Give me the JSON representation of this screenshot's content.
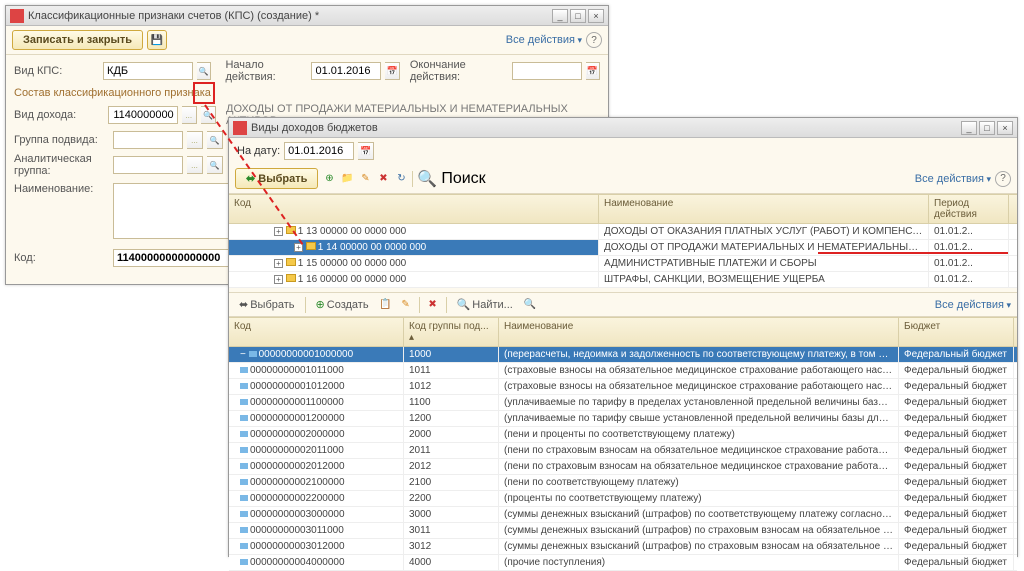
{
  "w1": {
    "title": "Классификационные признаки счетов (КПС) (создание) *",
    "save_close": "Записать и закрыть",
    "all_actions": "Все действия",
    "labels": {
      "vid_kps": "Вид КПС:",
      "nachalo": "Начало действия:",
      "okonchanie": "Окончание действия:",
      "sostav": "Состав классификационного признака",
      "vid_dohoda": "Вид дохода:",
      "gruppa": "Группа подвида:",
      "analit": "Аналитическая группа:",
      "naim": "Наименование:",
      "kod": "Код:"
    },
    "values": {
      "vid_kps": "КДБ",
      "nachalo": "01.01.2016",
      "vid_dohoda": "1140000000",
      "descr": "ДОХОДЫ ОТ ПРОДАЖИ МАТЕРИАЛЬНЫХ И НЕМАТЕРИАЛЬНЫХ АКТИВОВ",
      "kod": "11400000000000000"
    }
  },
  "w2": {
    "title": "Виды доходов бюджетов",
    "na_datu_label": "На дату:",
    "na_datu": "01.01.2016",
    "vybrat": "Выбрать",
    "poisk": "Поиск",
    "all_actions": "Все действия",
    "g1_headers": {
      "kod": "Код",
      "naim": "Наименование",
      "period": "Период действия"
    },
    "g1_rows": [
      {
        "kod": "1 13 00000 00 0000 000",
        "naim": "ДОХОДЫ ОТ ОКАЗАНИЯ ПЛАТНЫХ УСЛУГ (РАБОТ) И КОМПЕНСАЦИИ ЗАТРАТ ГОСУДАРСТВА",
        "period": "01.01.2..",
        "sel": false
      },
      {
        "kod": "1 14 00000 00 0000 000",
        "naim": "ДОХОДЫ ОТ ПРОДАЖИ МАТЕРИАЛЬНЫХ И НЕМАТЕРИАЛЬНЫХ АКТИВОВ",
        "period": "01.01.2..",
        "sel": true
      },
      {
        "kod": "1 15 00000 00 0000 000",
        "naim": "АДМИНИСТРАТИВНЫЕ ПЛАТЕЖИ И СБОРЫ",
        "period": "01.01.2..",
        "sel": false
      },
      {
        "kod": "1 16 00000 00 0000 000",
        "naim": "ШТРАФЫ, САНКЦИИ, ВОЗМЕЩЕНИЕ УЩЕРБА",
        "period": "01.01.2..",
        "sel": false
      }
    ],
    "toolbar2": {
      "vybrat": "Выбрать",
      "sozdat": "Создать",
      "naiti": "Найти..."
    },
    "g2_headers": {
      "kod": "Код",
      "grp": "Код группы под... ▴",
      "naim": "Наименование",
      "budget": "Бюджет"
    },
    "g2_rows": [
      {
        "kod": "00000000001000000",
        "grp": "1000",
        "naim": "(перерасчеты, недоимка и задолженность по соответствующему платежу, в том числе ...",
        "budget": "Федеральный бюджет",
        "sel": true
      },
      {
        "kod": "00000000001011000",
        "grp": "1011",
        "naim": "(страховые взносы на обязательное медицинское страхование работающего населени...",
        "budget": "Федеральный бюджет"
      },
      {
        "kod": "00000000001012000",
        "grp": "1012",
        "naim": "(страховые взносы на обязательное медицинское страхование работающего населени...",
        "budget": "Федеральный бюджет"
      },
      {
        "kod": "00000000001100000",
        "grp": "1100",
        "naim": "(уплачиваемые по тарифу в пределах установленной предельной величины базы для на...",
        "budget": "Федеральный бюджет"
      },
      {
        "kod": "00000000001200000",
        "grp": "1200",
        "naim": "(уплачиваемые по тарифу свыше установленной предельной величины базы для начисл...",
        "budget": "Федеральный бюджет"
      },
      {
        "kod": "00000000002000000",
        "grp": "2000",
        "naim": "(пени и проценты по соответствующему платежу)",
        "budget": "Федеральный бюджет"
      },
      {
        "kod": "00000000002011000",
        "grp": "2011",
        "naim": "(пени по страховым взносам на обязательное медицинское страхование работающего ...",
        "budget": "Федеральный бюджет"
      },
      {
        "kod": "00000000002012000",
        "grp": "2012",
        "naim": "(пени по страховым взносам на обязательное медицинское страхование работающего ...",
        "budget": "Федеральный бюджет"
      },
      {
        "kod": "00000000002100000",
        "grp": "2100",
        "naim": "(пени по соответствующему платежу)",
        "budget": "Федеральный бюджет"
      },
      {
        "kod": "00000000002200000",
        "grp": "2200",
        "naim": "(проценты по соответствующему платежу)",
        "budget": "Федеральный бюджет"
      },
      {
        "kod": "00000000003000000",
        "grp": "3000",
        "naim": "(суммы денежных взысканий (штрафов) по соответствующему платежу согласно закон...",
        "budget": "Федеральный бюджет"
      },
      {
        "kod": "00000000003011000",
        "grp": "3011",
        "naim": "(суммы денежных взысканий (штрафов) по страховым взносам на обязательное меди...",
        "budget": "Федеральный бюджет"
      },
      {
        "kod": "00000000003012000",
        "grp": "3012",
        "naim": "(суммы денежных взысканий (штрафов) по страховым взносам на обязательное меди...",
        "budget": "Федеральный бюджет"
      },
      {
        "kod": "00000000004000000",
        "grp": "4000",
        "naim": "(прочие поступления)",
        "budget": "Федеральный бюджет"
      }
    ]
  }
}
